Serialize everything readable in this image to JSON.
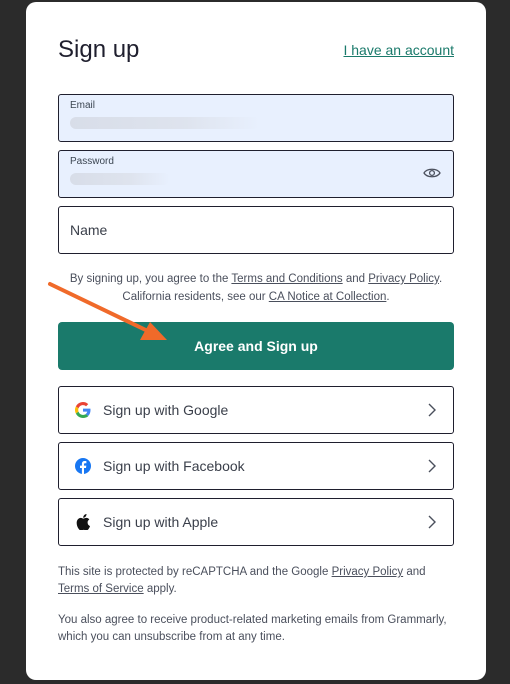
{
  "header": {
    "title": "Sign up",
    "account_link": "I have an account"
  },
  "form": {
    "email_label": "Email",
    "password_label": "Password",
    "name_placeholder": "Name"
  },
  "terms": {
    "pre": "By signing up, you agree to the ",
    "terms_link": "Terms and Conditions",
    "and": " and ",
    "privacy_link": "Privacy Policy",
    "dot": ".",
    "ca_pre": "California residents, see our ",
    "ca_link": "CA Notice at Collection",
    "ca_dot": "."
  },
  "primary_button": "Agree and Sign up",
  "social": {
    "google": "Sign up with Google",
    "facebook": "Sign up with Facebook",
    "apple": "Sign up with Apple"
  },
  "footer": {
    "recaptcha_pre": "This site is protected by reCAPTCHA and the Google ",
    "privacy_link": "Privacy Policy",
    "and": " and ",
    "tos_link": "Terms of Service",
    "apply": " apply.",
    "marketing": "You also agree to receive product-related marketing emails from Grammarly, which you can unsubscribe from at any time."
  },
  "colors": {
    "brand": "#1a7a6b",
    "annotation_arrow": "#f06a2a"
  }
}
